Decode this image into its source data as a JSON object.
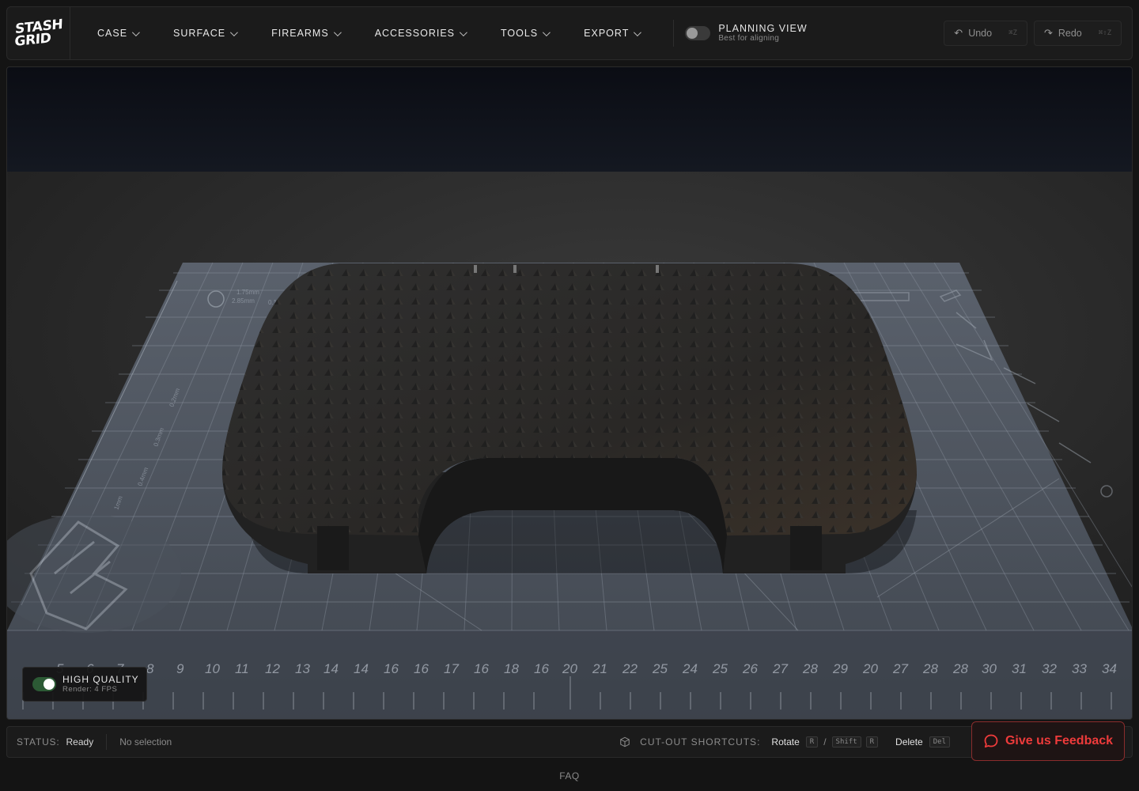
{
  "logo": {
    "line1": "STASH",
    "line2": "GRID"
  },
  "nav": [
    {
      "label": "CASE"
    },
    {
      "label": "SURFACE"
    },
    {
      "label": "FIREARMS"
    },
    {
      "label": "ACCESSORIES"
    },
    {
      "label": "TOOLS"
    },
    {
      "label": "EXPORT"
    }
  ],
  "planning": {
    "title": "PLANNING VIEW",
    "subtitle": "Best for aligning",
    "enabled": false
  },
  "history": {
    "undo": {
      "label": "Undo",
      "shortcut": "⌘Z",
      "icon": "undo-arrow-icon"
    },
    "redo": {
      "label": "Redo",
      "shortcut": "⌘⇧Z",
      "icon": "redo-arrow-icon"
    }
  },
  "viewport": {
    "ruler_numbers": [
      "5",
      "6",
      "7",
      "8",
      "9",
      "10",
      "11",
      "12",
      "13",
      "14",
      "14",
      "16",
      "16",
      "17",
      "16",
      "18",
      "16",
      "20",
      "21",
      "22",
      "25",
      "24",
      "25",
      "26",
      "27",
      "28",
      "29",
      "20",
      "27",
      "28",
      "28",
      "30",
      "31",
      "32",
      "33",
      "34"
    ],
    "mat_labels": [
      "1.75mm",
      "2.85mm",
      "0.1mm",
      "0.2mm",
      "0.3mm",
      "0.4mm",
      "1mm"
    ]
  },
  "quality": {
    "title": "HIGH QUALITY",
    "subtitle": "Render: 4 FPS",
    "enabled": true
  },
  "status": {
    "label": "STATUS:",
    "value": "Ready",
    "selection": "No selection",
    "shortcuts_label": "CUT-OUT SHORTCUTS:",
    "rotate_label": "Rotate",
    "rotate_key": "R",
    "shift_key": "Shift",
    "rotate_key2": "R",
    "delete_label": "Delete",
    "delete_key": "Del"
  },
  "feedback": {
    "label": "Give us Feedback",
    "icon": "chat-bubble-icon",
    "color": "#ee3b3b"
  },
  "footer": {
    "faq": "FAQ"
  },
  "colors": {
    "background": "#141414",
    "panel": "#1b1b1b",
    "mat": "#4a5260",
    "case": "#2c2c2c",
    "accent_red": "#ee3b3b",
    "toggle_on": "#2c5a35"
  }
}
